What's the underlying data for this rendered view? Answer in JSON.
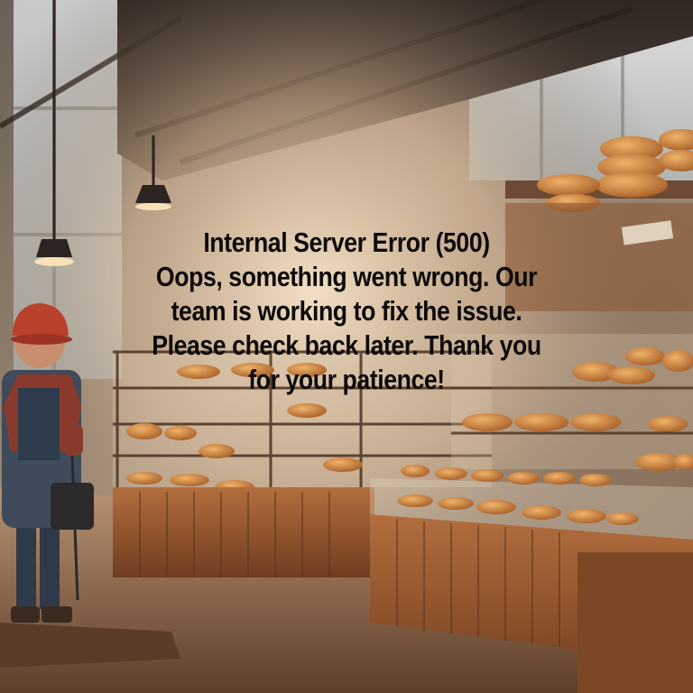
{
  "error": {
    "title": "Internal Server Error (500)",
    "message_lines": [
      "Oops, something went wrong. Our",
      "team is working to fix the issue.",
      "Please check back later. Thank you",
      "for your patience!"
    ]
  },
  "colors": {
    "text": "#0d0b0a",
    "warm_light": "#f4d9b3",
    "wood": "#9a5a32",
    "bread": "#d08a45",
    "helmet": "#b8412c"
  },
  "illustration": {
    "subject": "bakery-with-child-in-hardhat"
  }
}
